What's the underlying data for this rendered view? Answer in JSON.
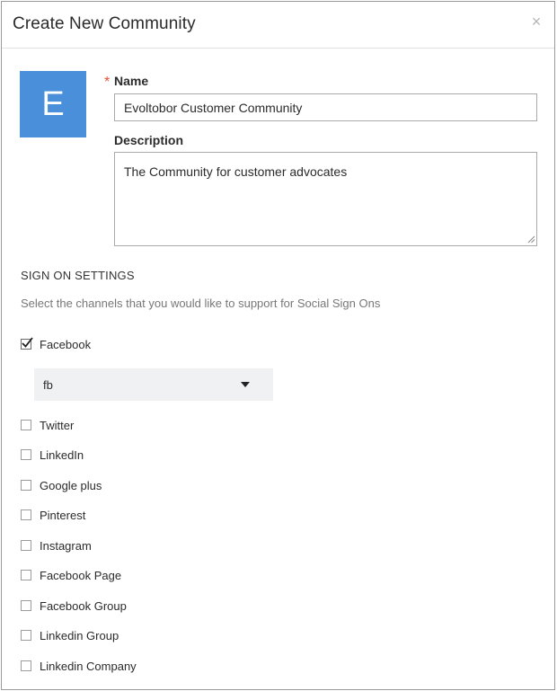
{
  "modal": {
    "title": "Create New Community",
    "close_glyph": "×"
  },
  "avatar": {
    "letter": "E",
    "color": "#4a8fd9"
  },
  "form": {
    "required_marker": "*",
    "name_label": "Name",
    "name_value": "Evoltobor Customer Community",
    "description_label": "Description",
    "description_value": "The Community for customer advocates"
  },
  "sign_on": {
    "title": "SIGN ON SETTINGS",
    "description": "Select the channels that you would like to support for Social Sign Ons",
    "facebook_select_value": "fb",
    "channels": [
      {
        "label": "Facebook",
        "checked": true
      },
      {
        "label": "Twitter",
        "checked": false
      },
      {
        "label": "LinkedIn",
        "checked": false
      },
      {
        "label": "Google plus",
        "checked": false
      },
      {
        "label": "Pinterest",
        "checked": false
      },
      {
        "label": "Instagram",
        "checked": false
      },
      {
        "label": "Facebook Page",
        "checked": false
      },
      {
        "label": "Facebook Group",
        "checked": false
      },
      {
        "label": "Linkedin Group",
        "checked": false
      },
      {
        "label": "Linkedin Company",
        "checked": false
      }
    ]
  },
  "colors": {
    "required": "#e0523a",
    "select_bg": "#f0f1f3"
  }
}
